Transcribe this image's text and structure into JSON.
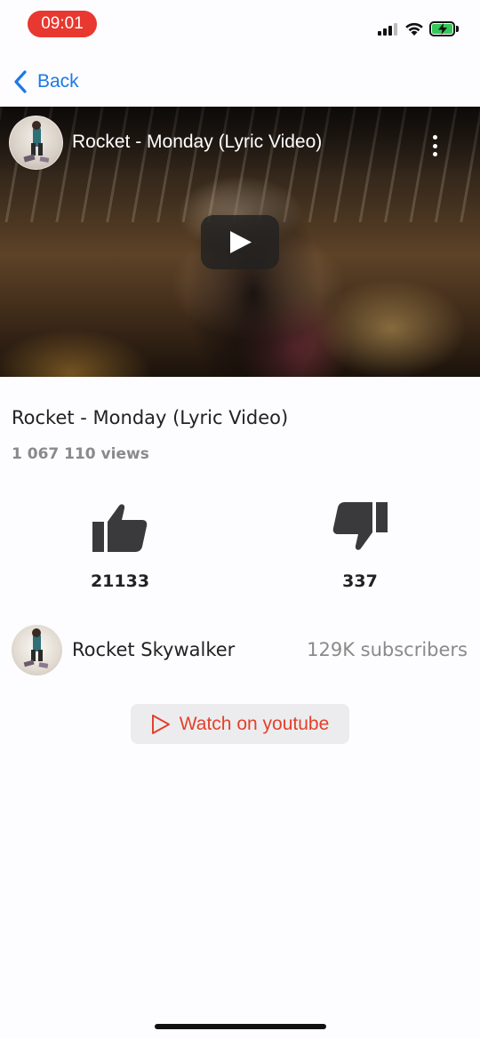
{
  "status_bar": {
    "time": "09:01",
    "time_pill_color": "#e8382f",
    "battery_color": "#34c759"
  },
  "nav": {
    "back_label": "Back",
    "accent_color": "#1a7ae6"
  },
  "video": {
    "overlay_title": "Rocket - Monday (Lyric Video)",
    "play_icon": "play-icon",
    "more_icon": "more-vertical-icon"
  },
  "details": {
    "title": "Rocket - Monday (Lyric Video)",
    "views": "1 067 110 views"
  },
  "reactions": {
    "likes": "21133",
    "dislikes": "337",
    "like_icon": "thumbs-up-icon",
    "dislike_icon": "thumbs-down-icon"
  },
  "channel": {
    "name": "Rocket Skywalker",
    "subscribers": "129K subscribers"
  },
  "watch_button": {
    "label": "Watch on youtube",
    "icon": "play-outline-icon",
    "color": "#e4402a"
  }
}
